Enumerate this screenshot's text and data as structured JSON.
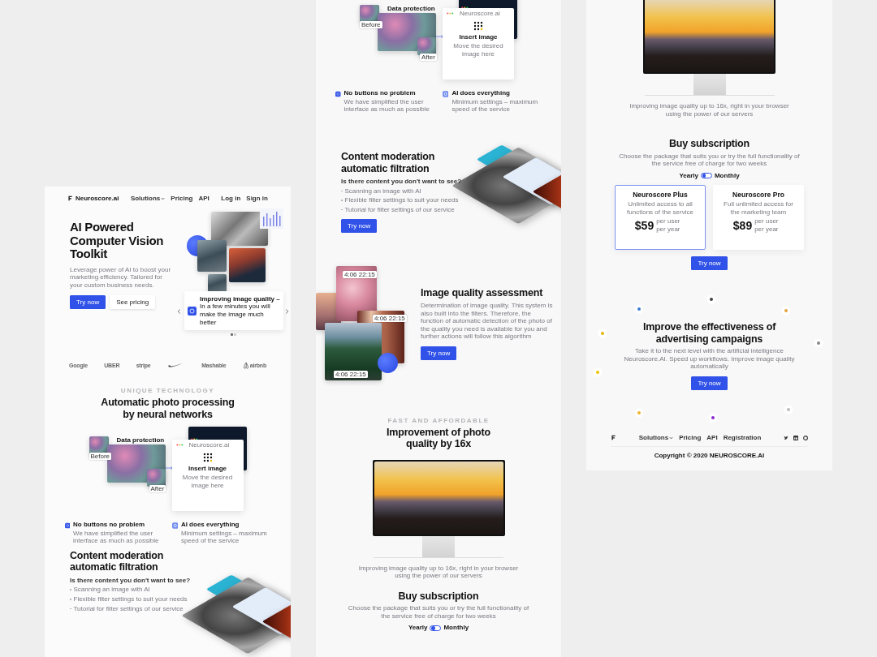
{
  "board": {
    "columns": [
      {
        "sections": [
          {
            "kind": "nav",
            "brand": "Neuroscore.ai",
            "links": [
              {
                "label": "Solutions",
                "dropdown": true
              },
              {
                "label": "Pricing",
                "dropdown": false
              },
              {
                "label": "API",
                "dropdown": false
              }
            ],
            "actions": [
              "Log in",
              "Sign in"
            ]
          },
          {
            "kind": "hero",
            "title": "AI Powered Computer Vision Toolkit",
            "text": "Leverage power of AI to boost your marketing efficiency. Tailored for your custom business needs.",
            "buttons": [
              {
                "label": "Try now",
                "kind": "primary"
              },
              {
                "label": "See pricing",
                "kind": "secondary"
              }
            ],
            "card": "**Improving image quality –** In a few minutes you will make the image much better",
            "dots": [
              {
                "selected": true
              },
              {
                "selected": false
              }
            ]
          },
          {
            "kind": "logos",
            "items": [
              {
                "kind": "wordmark",
                "label": "Google"
              },
              {
                "kind": "wordmark",
                "label": "UBER"
              },
              {
                "kind": "wordmark",
                "label": "stripe"
              },
              {
                "kind": "swoosh"
              },
              {
                "kind": "wordmark",
                "label": "Mashable"
              },
              {
                "kind": "airbnb",
                "label": "airbnb"
              }
            ]
          },
          {
            "kind": "intro",
            "eyebrow": "UNIQUE TECHNOLOGY",
            "title": "Automatic photo processing by neural networks",
            "illustration": {
              "label": "Data protection",
              "before": "Before",
              "after": "After",
              "window_title": "Neuroscore.ai",
              "card_title": "Insert image",
              "card_text": "Move the desired image here"
            },
            "features": [
              {
                "title": "No buttons no problem",
                "text": "We have simplified the user interface as much as possible"
              },
              {
                "title": "AI does everything",
                "text": "Minimum settings – maximum speed of the service"
              }
            ]
          },
          {
            "kind": "moderation",
            "title": "Content moderation automatic filtration",
            "lead": "Is there content you don't want to see?",
            "bullets": [
              "Scanning an image with AI",
              "Flexible filter settings to suit your needs",
              "Tutorial for filter settings of our service"
            ]
          }
        ]
      },
      {
        "sections": [
          {
            "kind": "intro",
            "illustration": {
              "label": "Data protection",
              "before": "Before",
              "after": "After",
              "window_title": "Neuroscore.ai",
              "card_title": "Insert image",
              "card_text": "Move the desired image here"
            },
            "features": [
              {
                "title": "No buttons no problem",
                "text": "We have simplified the user interface as much as possible"
              },
              {
                "title": "AI does everything",
                "text": "Minimum settings – maximum speed of the service"
              }
            ]
          },
          {
            "kind": "moderation",
            "title": "Content moderation automatic filtration",
            "lead": "Is there content you don't want to see?",
            "bullets": [
              "Scanning an image with AI",
              "Flexible filter settings to suit your needs",
              "Tutorial for filter settings of our service"
            ],
            "button": "Try now"
          },
          {
            "kind": "quality",
            "title": "Image quality assessment",
            "text": "Determination of image quality. This system is also built into the filters. Therefore, the function of automatic detection of the photo of the quality you need is available for you and further actions will follow this algorithm",
            "button": "Try now",
            "photo_labels": [
              "4:06 22:15",
              "4:06 22:15",
              "4:06 22:15"
            ]
          },
          {
            "kind": "monitor",
            "eyebrow": "FAST AND AFFORDABLE",
            "title": "Improvement of photo quality by 16x",
            "caption": "Improving image quality up to 16x, right in your browser using the power of our servers"
          },
          {
            "kind": "pricing",
            "title": "Buy subscription",
            "text": "Choose the package that suits you or try the full functionality of the service free of charge for two weeks",
            "toggle": {
              "left": "Yearly",
              "right": "Monthly",
              "monthly": false
            }
          }
        ]
      },
      {
        "sections": [
          {
            "kind": "monitor",
            "caption": "Improving image quality up to 16x, right in your browser using the power of our servers"
          },
          {
            "kind": "pricing",
            "title": "Buy subscription",
            "text": "Choose the package that suits you or try the full functionality of the service free of charge for two weeks",
            "toggle": {
              "left": "Yearly",
              "right": "Monthly",
              "monthly": false
            },
            "plans": [
              {
                "name": "Neuroscore Plus",
                "text": "Unlimited access to all functions of the service",
                "price": "$59",
                "unit": "per user per year",
                "selected": true
              },
              {
                "name": "Neuroscore Pro",
                "text": "Full unlimited access for the marketing team",
                "price": "$89",
                "unit": "per user per year",
                "selected": false
              }
            ],
            "button": "Try now"
          },
          {
            "kind": "cta",
            "title": "Improve the effectiveness of advertising campaigns",
            "text": "Take it to the next level with the artificial intelligence Neuroscore.AI. Speed up workflows. Improve image quality automatically",
            "button": "Try now"
          },
          {
            "kind": "footer",
            "links": [
              {
                "label": "Solutions",
                "dropdown": true
              },
              {
                "label": "Pricing",
                "dropdown": false
              },
              {
                "label": "API",
                "dropdown": false
              },
              {
                "label": "Registration",
                "dropdown": false
              }
            ],
            "copyright": "Copyright © 2020 NEUROSCORE.AI"
          }
        ]
      }
    ]
  }
}
